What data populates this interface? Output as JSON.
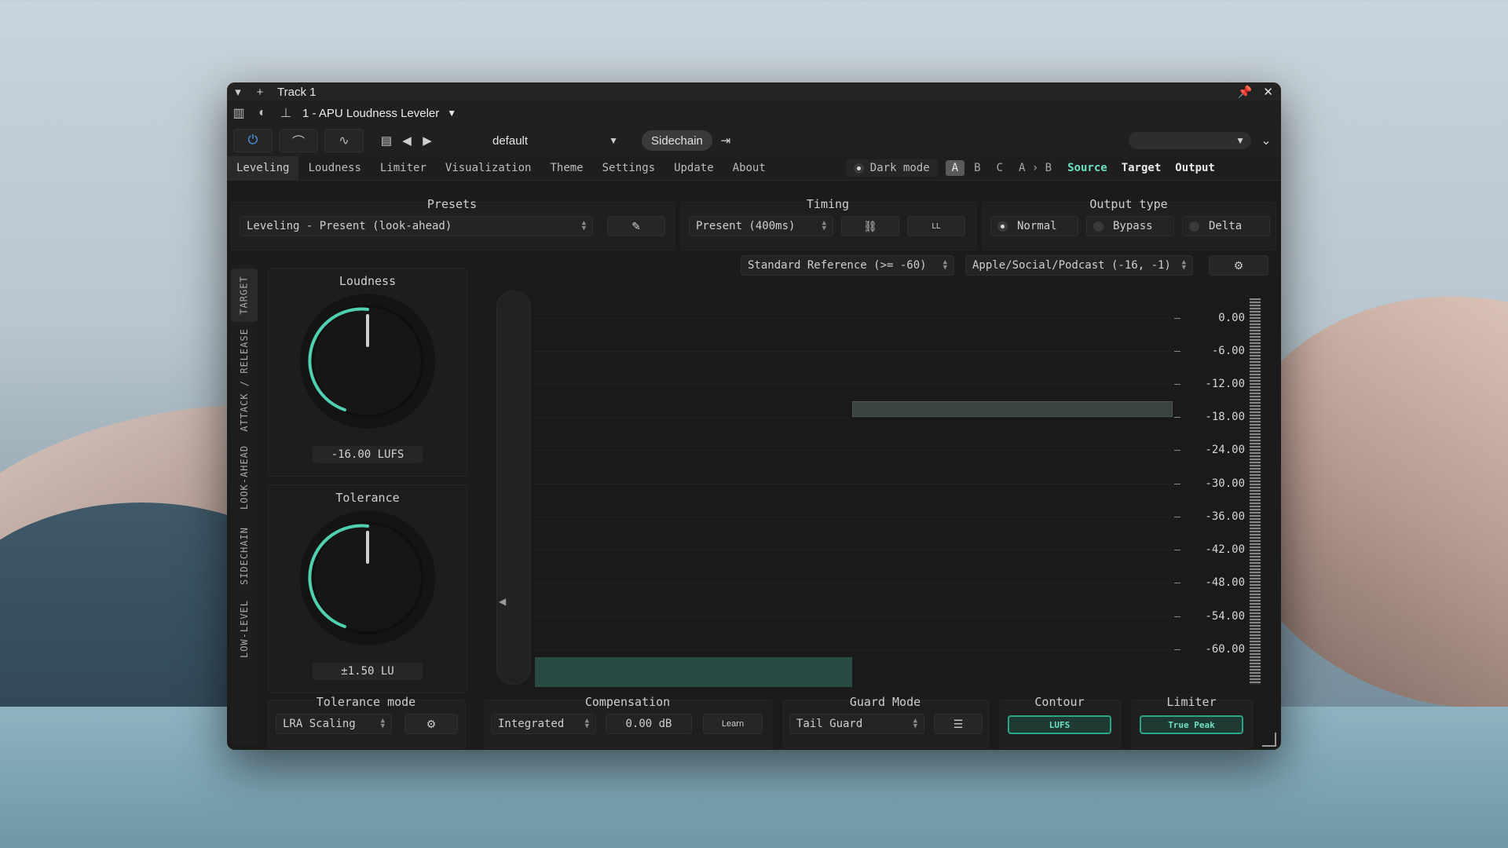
{
  "window": {
    "title": "Track 1",
    "plugin_name": "1 - APU Loudness Leveler",
    "preset": "default",
    "sidechain_label": "Sidechain"
  },
  "tabs": [
    "Leveling",
    "Loudness",
    "Limiter",
    "Visualization",
    "Theme",
    "Settings",
    "Update",
    "About"
  ],
  "dark_mode_label": "Dark mode",
  "ab": [
    "A",
    "B",
    "C",
    "A › B"
  ],
  "sto": {
    "source": "Source",
    "target": "Target",
    "output": "Output"
  },
  "presets": {
    "label": "Presets",
    "value": "Leveling - Present (look-ahead)"
  },
  "timing": {
    "label": "Timing",
    "value": "Present (400ms)",
    "ll": "LL"
  },
  "output_type": {
    "label": "Output type",
    "options": [
      "Normal",
      "Bypass",
      "Delta"
    ],
    "selected": "Normal"
  },
  "side_tabs": [
    "TARGET",
    "ATTACK / RELEASE",
    "LOOK-AHEAD",
    "SIDECHAIN",
    "LOW-LEVEL"
  ],
  "loudness": {
    "label": "Loudness",
    "value": "-16.00 LUFS"
  },
  "tolerance": {
    "label": "Tolerance",
    "value": "±1.50 LU"
  },
  "reference": "Standard Reference (>= -60)",
  "target_preset": "Apple/Social/Podcast (-16, -1)",
  "scale": [
    "0.00",
    "-6.00",
    "-12.00",
    "-18.00",
    "-24.00",
    "-30.00",
    "-36.00",
    "-42.00",
    "-48.00",
    "-54.00",
    "-60.00"
  ],
  "bottom": {
    "tolerance_mode": {
      "label": "Tolerance mode",
      "value": "LRA Scaling"
    },
    "compensation": {
      "label": "Compensation",
      "mode": "Integrated",
      "value": "0.00 dB",
      "learn": "Learn"
    },
    "guard_mode": {
      "label": "Guard Mode",
      "value": "Tail Guard"
    },
    "contour": {
      "label": "Contour",
      "value": "LUFS"
    },
    "limiter": {
      "label": "Limiter",
      "value": "True Peak"
    }
  },
  "colors": {
    "accent": "#6ee0c4",
    "power": "#4ea4ff",
    "background": "#1b1b1b"
  }
}
